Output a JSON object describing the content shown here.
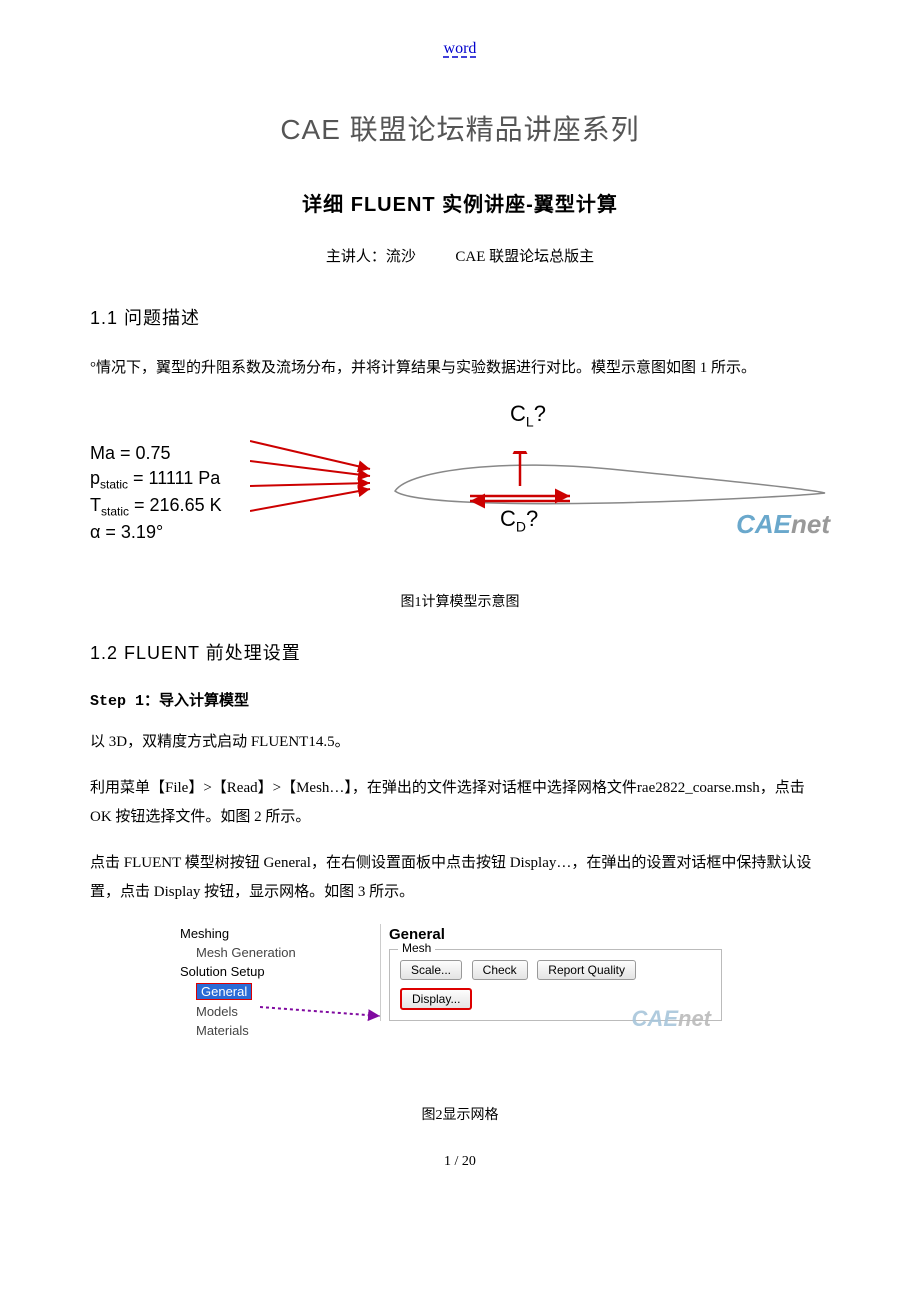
{
  "header_link": "word",
  "title_series": "CAE 联盟论坛精品讲座系列",
  "title_main": "详细 FLUENT 实例讲座-翼型计算",
  "lecturer_prefix": "主讲人：流沙",
  "lecturer_org": "CAE 联盟论坛总版主",
  "section_1_1": "1.1 问题描述",
  "para_problem": "°情况下，翼型的升阻系数及流场分布，并将计算结果与实验数据进行对比。模型示意图如图 1 所示。",
  "fig1": {
    "Ma": "Ma = 0.75",
    "p": "pstatic = 11111 Pa",
    "T": "Tstatic = 216.65 K",
    "alpha": "α = 3.19°",
    "CL": "CL?",
    "CD": "CD?",
    "brand_cae": "CAE",
    "brand_net": "net",
    "caption": "图1计算模型示意图"
  },
  "section_1_2": "1.2 FLUENT 前处理设置",
  "step1_h": "Step 1：导入计算模型",
  "para_step1_a": "以 3D，双精度方式启动 FLUENT14.5。",
  "para_step1_b": "利用菜单【File】>【Read】>【Mesh…】，在弹出的文件选择对话框中选择网格文件rae2822_coarse.msh，点击 OK 按钮选择文件。如图 2 所示。",
  "para_step1_c": "点击 FLUENT 模型树按钮 General，在右侧设置面板中点击按钮 Display…，在弹出的设置对话框中保持默认设置，点击 Display 按钮，显示网格。如图 3 所示。",
  "fig2": {
    "tree_meshing": "Meshing",
    "tree_meshgen": "Mesh Generation",
    "tree_setup": "Solution Setup",
    "tree_general": "General",
    "tree_models": "Models",
    "tree_materials": "Materials",
    "panel_title": "General",
    "group_label": "Mesh",
    "btn_scale": "Scale...",
    "btn_check": "Check",
    "btn_report": "Report Quality",
    "btn_display": "Display...",
    "brand_cae": "CAE",
    "brand_net": "net",
    "caption": "图2显示网格"
  },
  "page_num": "1 / 20"
}
